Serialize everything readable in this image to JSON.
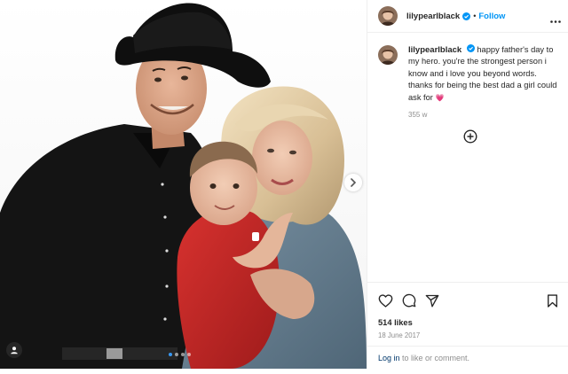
{
  "post": {
    "username": "lilypearlblack",
    "follow_label": "Follow",
    "separator": "•",
    "caption": "happy father's day to my hero. you're the strongest person i know and i love you beyond words. thanks for being the best dad a girl could ask for",
    "caption_emoji": "💗",
    "comment_age": "355 w",
    "likes": "514 likes",
    "date": "18 June 2017",
    "carousel": {
      "slides": 4,
      "active_index": 0
    }
  },
  "login_prompt": {
    "link": "Log in",
    "rest": " to like or comment."
  },
  "icons": {
    "verified": "verified-badge-icon",
    "more": "more-options-icon",
    "next": "chevron-right-icon",
    "user_tag": "user-tag-icon",
    "load_more": "add-circle-icon",
    "like": "heart-icon",
    "comment": "comment-icon",
    "share": "paper-plane-icon",
    "save": "bookmark-icon"
  },
  "colors": {
    "accent": "#0095f6",
    "link_dark": "#00376b",
    "muted": "#8e8e8e",
    "text": "#262626"
  }
}
